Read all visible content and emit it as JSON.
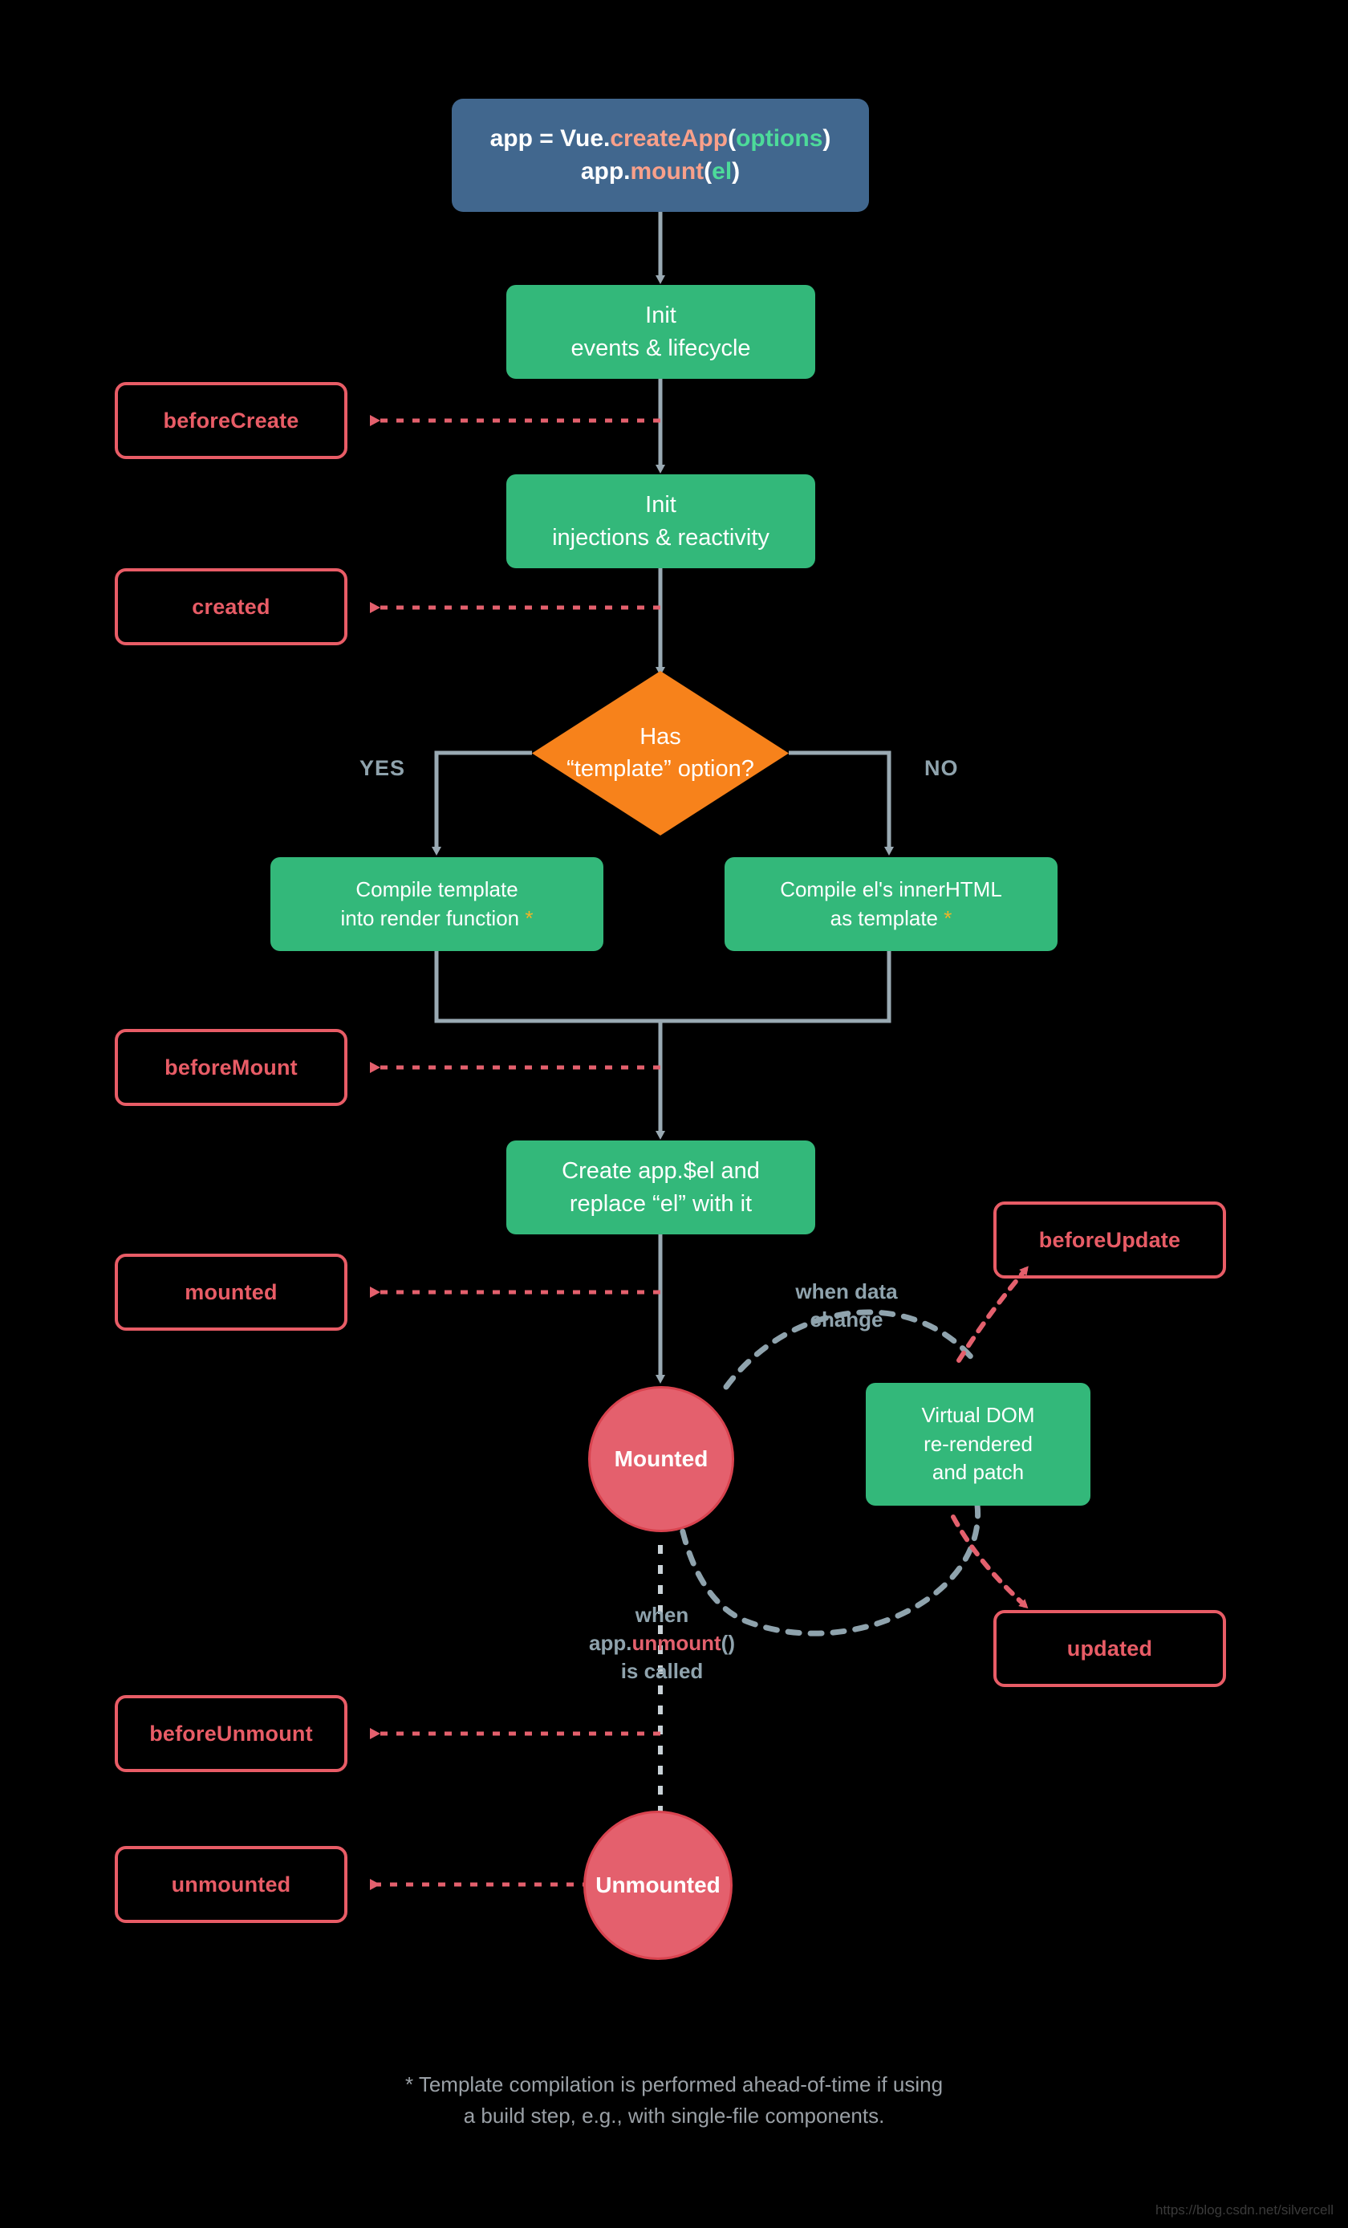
{
  "diagram": {
    "title": "Vue 3 Instance Lifecycle",
    "background": "#000000",
    "colors": {
      "start": "#41678e",
      "process": "#33b87a",
      "decision": "#f7821b",
      "state": "#e4606d",
      "hook": "#e85c66",
      "wire": "#8fa3ad",
      "star": "#f0b429"
    }
  },
  "start_box": {
    "line1": {
      "t1": "app = Vue.",
      "t2": "createApp",
      "t3": "(",
      "t4": "options",
      "t5": ")"
    },
    "line2": {
      "t1": "app.",
      "t2": "mount",
      "t3": "(",
      "t4": "el",
      "t5": ")"
    }
  },
  "process_nodes": {
    "init_events": {
      "line1": "Init",
      "line2": "events & lifecycle"
    },
    "init_injections": {
      "line1": "Init",
      "line2": "injections & reactivity"
    },
    "compile_template": {
      "line1": "Compile template",
      "line2": "into render function ",
      "star": "*"
    },
    "compile_innerhtml": {
      "line1": "Compile el's innerHTML",
      "line2": "as template ",
      "star": "*"
    },
    "create_el": {
      "line1": "Create app.$el and",
      "line2": "replace “el” with it"
    },
    "virtual_dom": {
      "line1": "Virtual DOM",
      "line2": "re-rendered",
      "line3": "and patch"
    }
  },
  "decision": {
    "line1": "Has",
    "line2": "“template” option?",
    "yes_label": "YES",
    "no_label": "NO"
  },
  "state_nodes": {
    "mounted": "Mounted",
    "unmounted": "Unmounted"
  },
  "hooks": {
    "before_create": "beforeCreate",
    "created": "created",
    "before_mount": "beforeMount",
    "mounted": "mounted",
    "before_update": "beforeUpdate",
    "updated": "updated",
    "before_unmount": "beforeUnmount",
    "unmounted": "unmounted"
  },
  "flow_notes": {
    "when_data_change": {
      "line1": "when data",
      "line2": "change"
    },
    "when_unmount": {
      "line1": "when",
      "line2_pre": "app.",
      "line2_red": "unmount",
      "line2_post": "()",
      "line3": "is called"
    }
  },
  "footnote": {
    "line1": "* Template compilation is performed ahead-of-time if using",
    "line2": "a build step, e.g., with single-file components."
  },
  "watermark": "https://blog.csdn.net/silvercell"
}
